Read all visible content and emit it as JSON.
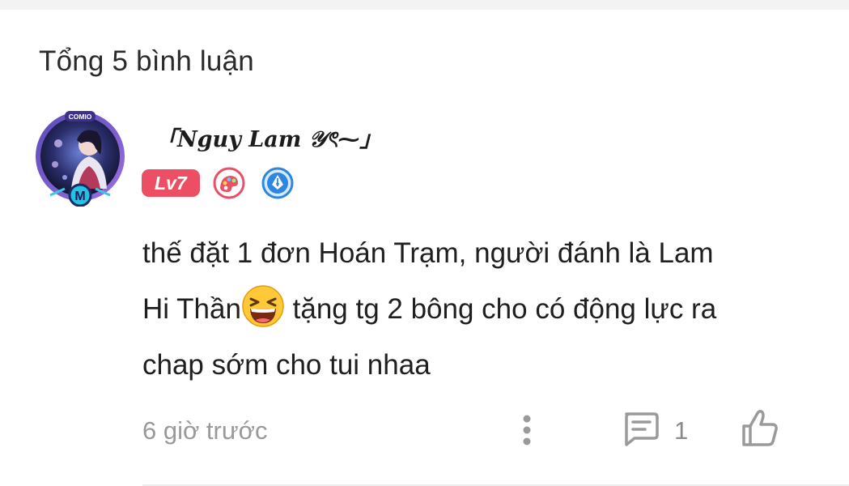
{
  "comments_header": {
    "total_label": "Tổng 5 bình luận"
  },
  "comment": {
    "username": "「Nguy Lam 𝒴ৎ⁓」",
    "level_badge": "Lv7",
    "avatar_tag": "COMIO",
    "avatar_letter": "M",
    "badges": [
      {
        "icon": "art-palette-icon",
        "color": "#ec4f63"
      },
      {
        "icon": "pen-nib-icon",
        "color": "#2f86e0"
      }
    ],
    "text_part1": "thế đặt 1 đơn Hoán Trạm, người đánh là Lam",
    "text_part2a": "Hi Thần",
    "emoji": "grinning-squinting-face-icon",
    "text_part2b": " tặng tg 2 bông cho có động lực ra",
    "text_part3": "chap sớm cho tui nhaa",
    "timestamp": "6 giờ trước",
    "reply_count": "1"
  },
  "colors": {
    "level_badge_bg": "#ec4f63",
    "secondary_text": "#999999",
    "icon_gray": "#9a9a9a"
  }
}
